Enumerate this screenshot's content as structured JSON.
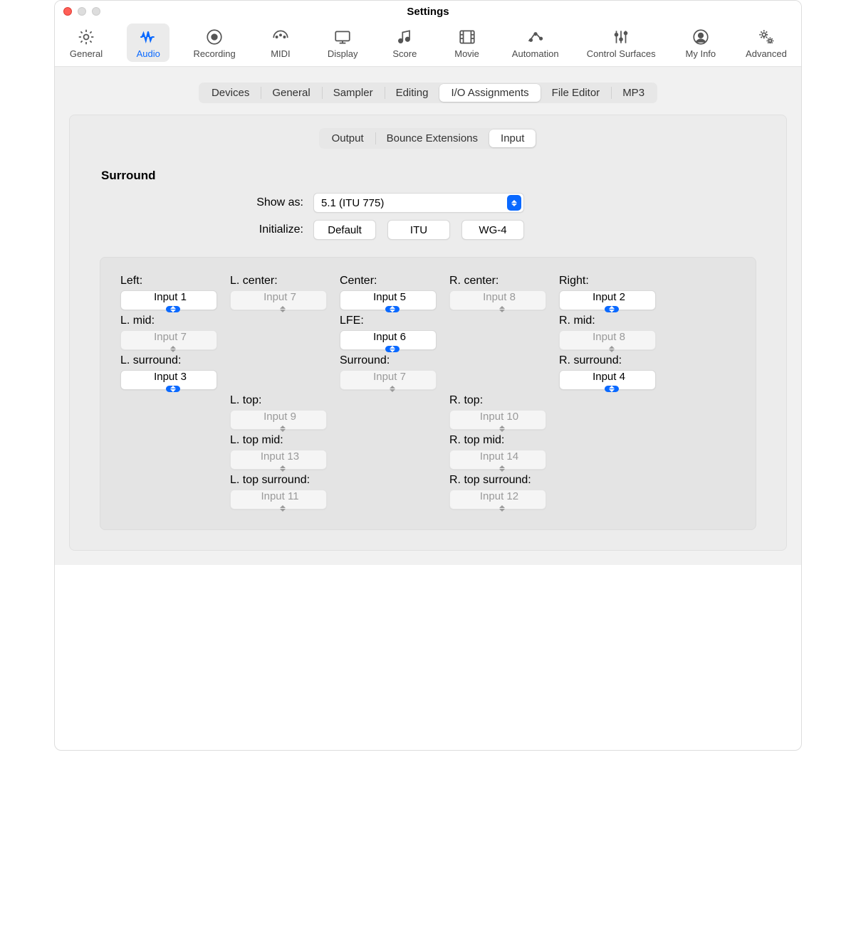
{
  "window": {
    "title": "Settings"
  },
  "toolbar": [
    {
      "id": "general",
      "label": "General"
    },
    {
      "id": "audio",
      "label": "Audio"
    },
    {
      "id": "recording",
      "label": "Recording"
    },
    {
      "id": "midi",
      "label": "MIDI"
    },
    {
      "id": "display",
      "label": "Display"
    },
    {
      "id": "score",
      "label": "Score"
    },
    {
      "id": "movie",
      "label": "Movie"
    },
    {
      "id": "automation",
      "label": "Automation"
    },
    {
      "id": "control-surfaces",
      "label": "Control Surfaces"
    },
    {
      "id": "my-info",
      "label": "My Info"
    },
    {
      "id": "advanced",
      "label": "Advanced"
    }
  ],
  "toolbar_selected": "audio",
  "tabs1": [
    "Devices",
    "General",
    "Sampler",
    "Editing",
    "I/O Assignments",
    "File Editor",
    "MP3"
  ],
  "tabs1_selected": "I/O Assignments",
  "tabs2": [
    "Output",
    "Bounce Extensions",
    "Input"
  ],
  "tabs2_selected": "Input",
  "section": "Surround",
  "show_as": {
    "label": "Show as:",
    "value": "5.1 (ITU 775)"
  },
  "initialize": {
    "label": "Initialize:",
    "buttons": [
      "Default",
      "ITU",
      "WG-4"
    ]
  },
  "channels": {
    "left": {
      "label": "Left:",
      "value": "Input 1",
      "enabled": true
    },
    "l_center": {
      "label": "L. center:",
      "value": "Input 7",
      "enabled": false
    },
    "center": {
      "label": "Center:",
      "value": "Input 5",
      "enabled": true
    },
    "r_center": {
      "label": "R. center:",
      "value": "Input 8",
      "enabled": false
    },
    "right": {
      "label": "Right:",
      "value": "Input 2",
      "enabled": true
    },
    "l_mid": {
      "label": "L. mid:",
      "value": "Input 7",
      "enabled": false
    },
    "lfe": {
      "label": "LFE:",
      "value": "Input 6",
      "enabled": true
    },
    "r_mid": {
      "label": "R. mid:",
      "value": "Input 8",
      "enabled": false
    },
    "l_surround": {
      "label": "L. surround:",
      "value": "Input 3",
      "enabled": true
    },
    "surround": {
      "label": "Surround:",
      "value": "Input 7",
      "enabled": false
    },
    "r_surround": {
      "label": "R. surround:",
      "value": "Input 4",
      "enabled": true
    },
    "l_top": {
      "label": "L. top:",
      "value": "Input 9",
      "enabled": false
    },
    "r_top": {
      "label": "R. top:",
      "value": "Input 10",
      "enabled": false
    },
    "l_top_mid": {
      "label": "L. top mid:",
      "value": "Input 13",
      "enabled": false
    },
    "r_top_mid": {
      "label": "R. top mid:",
      "value": "Input 14",
      "enabled": false
    },
    "l_top_surround": {
      "label": "L. top surround:",
      "value": "Input 11",
      "enabled": false
    },
    "r_top_surround": {
      "label": "R. top surround:",
      "value": "Input 12",
      "enabled": false
    }
  },
  "grid_layout": [
    [
      "left",
      "l_center",
      "center",
      "r_center",
      "right"
    ],
    [
      "l_mid",
      null,
      "lfe",
      null,
      "r_mid"
    ],
    [
      "l_surround",
      null,
      "surround",
      null,
      "r_surround"
    ],
    [
      null,
      "l_top",
      null,
      "r_top",
      null
    ],
    [
      null,
      "l_top_mid",
      null,
      "r_top_mid",
      null
    ],
    [
      null,
      "l_top_surround",
      null,
      "r_top_surround",
      null
    ]
  ]
}
